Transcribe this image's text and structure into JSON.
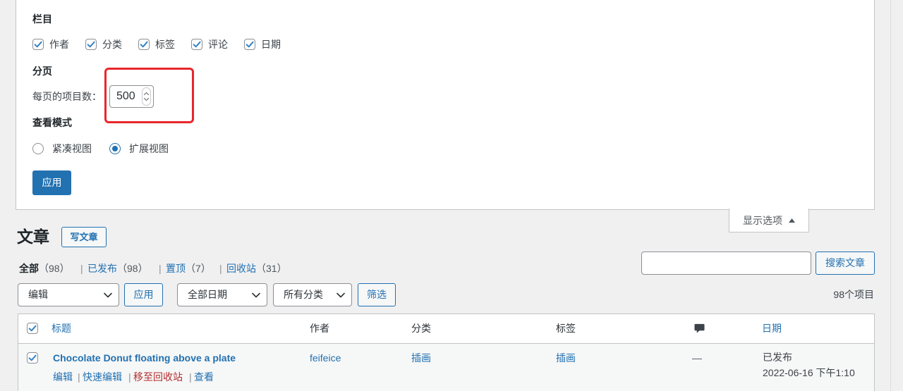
{
  "colors": {
    "accent": "#2271b1",
    "check": "#3582c4",
    "trash": "#b32d2e",
    "annotation": "#e8272c",
    "background": "#f0f0f1"
  },
  "separator": "|",
  "screen_options": {
    "columns_heading": "栏目",
    "columns": [
      {
        "label": "作者",
        "checked": true
      },
      {
        "label": "分类",
        "checked": true
      },
      {
        "label": "标签",
        "checked": true
      },
      {
        "label": "评论",
        "checked": true
      },
      {
        "label": "日期",
        "checked": true
      }
    ],
    "pagination_heading": "分页",
    "per_page_label": "每页的项目数：",
    "per_page_value": "500",
    "view_mode_heading": "查看模式",
    "view_modes": [
      {
        "label": "紧凑视图",
        "selected": false
      },
      {
        "label": "扩展视图",
        "selected": true
      }
    ],
    "apply_label": "应用",
    "toggle_label": "显示选项",
    "toggle_icon": "caret-up-icon"
  },
  "page": {
    "title": "文章",
    "add_new_label": "写文章"
  },
  "views": [
    {
      "label": "全部",
      "count": "（98）",
      "current": true
    },
    {
      "label": "已发布",
      "count": "（98）",
      "current": false
    },
    {
      "label": "置顶",
      "count": "（7）",
      "current": false
    },
    {
      "label": "回收站",
      "count": "（31）",
      "current": false
    }
  ],
  "search": {
    "value": "",
    "button_label": "搜索文章"
  },
  "tablenav": {
    "bulk_action": "编辑",
    "apply_label": "应用",
    "date_filter": "全部日期",
    "category_filter": "所有分类",
    "filter_label": "筛选",
    "items_count": "98个项目"
  },
  "table": {
    "columns": {
      "select_all_checked": true,
      "title": "标题",
      "author": "作者",
      "categories": "分类",
      "tags": "标签",
      "comments_icon": "comment-bubble-icon",
      "date": "日期"
    },
    "rows": [
      {
        "checked": true,
        "title": "Chocolate Donut floating above a plate",
        "actions": {
          "edit": "编辑",
          "quick_edit": "快速编辑",
          "trash": "移至回收站",
          "view": "查看"
        },
        "author": "feifeice",
        "categories": "插画",
        "tags": "插画",
        "comments": "—",
        "date_status": "已发布",
        "date": "2022-06-16 下午1:10"
      }
    ]
  }
}
